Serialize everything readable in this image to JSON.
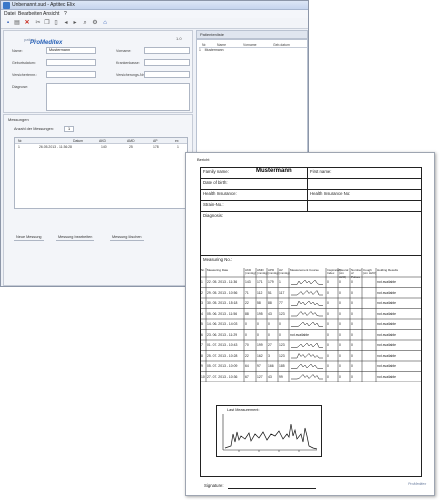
{
  "window": {
    "title": "Unbenannt.sud - Aptitec Elix"
  },
  "menu": [
    "Datei",
    "Bearbeiten",
    "Ansicht",
    "?"
  ],
  "toolbar_icons": [
    "save-icon",
    "print-icon",
    "delete-icon",
    "cut-icon",
    "copy-icon",
    "paste-icon",
    "arrow-left-icon",
    "arrow-right-icon",
    "search-icon",
    "tools-icon",
    "home-icon"
  ],
  "brand": {
    "line1": "patient",
    "line2": "ProMeditex"
  },
  "version": "1.0",
  "form": {
    "name_label": "Name:",
    "name_value": "Mustermann",
    "vorname_label": "Vorname:",
    "vorname_value": "",
    "geburtsdatum_label": "Geburtsdatum:",
    "krankenkasse_label": "Krankenkasse:",
    "versichertennr_label": "Versichertennr.:",
    "versicherungsnr_label": "Versicherungs-Nr.:",
    "diagnose_label": "Diagnose:"
  },
  "right_panel": {
    "header": "Patientenliste",
    "cols": [
      "Nr.",
      "Name",
      "Vorname",
      "Geb.datum"
    ],
    "row": {
      "nr": "1",
      "name": "Mustermann"
    }
  },
  "measurements": {
    "title": "Messungen",
    "count_label": "Anzahl der Messungen:",
    "count": "1",
    "columns": [
      "Nr.",
      "Datum",
      "AKD",
      "AMD",
      "AP",
      "ex"
    ],
    "rows": [
      {
        "nr": "1",
        "date": "26.05.2013 - 11:36:28",
        "akd": "140",
        "amd": "25",
        "ap": "178",
        "ex": "1"
      }
    ],
    "tabs": [
      "Neue Messung",
      "Messung bearbeiten",
      "Messung löschen"
    ]
  },
  "report": {
    "title": "Bericht",
    "family_label": "Family name:",
    "family_value": "Mustermann",
    "first_label": "First name:",
    "dob_label": "Date of birth:",
    "insurance_label": "Health Insurance:",
    "insurance_no_label": "Health Insurance No:",
    "strain_label": "Strain-No.:",
    "diagnosis_label": "Diagnosis:",
    "measuring_no_label": "Measuring No.:",
    "columns": [
      "Nr.",
      "Measuring Date",
      "AKD (mmHg)",
      "AMD (mmHg)",
      "APD (mmHg)",
      "AV (mmHg)",
      "Measurement Course",
      "Inspiratory Index",
      "Pleural (cm H2O)",
      "Number of Pulses",
      "Cough (cm H2O)",
      "Holding Results"
    ],
    "rows": [
      {
        "nr": "1",
        "date": "22. 05. 2013 - 11:36",
        "akd": "143",
        "amd": "171",
        "apd": "179",
        "av": "1",
        "course": "wave",
        "i": "0",
        "p": "0",
        "n": "0",
        "result": "not available"
      },
      {
        "nr": "2",
        "date": "29. 05. 2013 - 10:56",
        "akd": "71",
        "amd": "112",
        "apd": "51",
        "av": "117",
        "course": "wave",
        "i": "0",
        "p": "0",
        "n": "0",
        "result": "not available"
      },
      {
        "nr": "3",
        "date": "30. 05. 2013 - 15:18",
        "akd": "22",
        "amd": "58",
        "apd": "88",
        "av": "77",
        "course": "wave",
        "i": "0",
        "p": "0",
        "n": "0",
        "result": "not available"
      },
      {
        "nr": "4",
        "date": "05. 06. 2013 - 11:56",
        "akd": "88",
        "amd": "195",
        "apd": "43",
        "av": "123",
        "course": "wave",
        "i": "0",
        "p": "0",
        "n": "0",
        "result": "not available"
      },
      {
        "nr": "5",
        "date": "14. 06. 2013 - 14:03",
        "akd": "0",
        "amd": "0",
        "apd": "0",
        "av": "0",
        "course": "wave",
        "i": "0",
        "p": "0",
        "n": "0",
        "result": "not available"
      },
      {
        "nr": "6",
        "date": "23. 06. 2013 - 11:29",
        "akd": "0",
        "amd": "0",
        "apd": "0",
        "av": "0",
        "course": "not available",
        "i": "0",
        "p": "0",
        "n": "0",
        "result": "not available"
      },
      {
        "nr": "7",
        "date": "01. 07. 2013 - 10:43",
        "akd": "70",
        "amd": "199",
        "apd": "27",
        "av": "123",
        "course": "wave",
        "i": "0",
        "p": "0",
        "n": "0",
        "result": "not available"
      },
      {
        "nr": "8",
        "date": "25. 07. 2013 - 10:28",
        "akd": "22",
        "amd": "162",
        "apd": "3",
        "av": "123",
        "course": "wave",
        "i": "0",
        "p": "0",
        "n": "0",
        "result": "not available"
      },
      {
        "nr": "9",
        "date": "05. 07. 2013 - 10:09",
        "akd": "64",
        "amd": "97",
        "apd": "166",
        "av": "185",
        "course": "wave",
        "i": "0",
        "p": "0",
        "n": "0",
        "result": "not available"
      },
      {
        "nr": "10",
        "date": "27. 07. 2013 - 10:36",
        "akd": "67",
        "amd": "127",
        "apd": "43",
        "av": "99",
        "course": "wave",
        "i": "0",
        "p": "0",
        "n": "0",
        "result": "not available"
      }
    ],
    "last_measurement_label": "Last Measurement:",
    "signature_label": "Signature:",
    "logo": "ProMeditex"
  }
}
